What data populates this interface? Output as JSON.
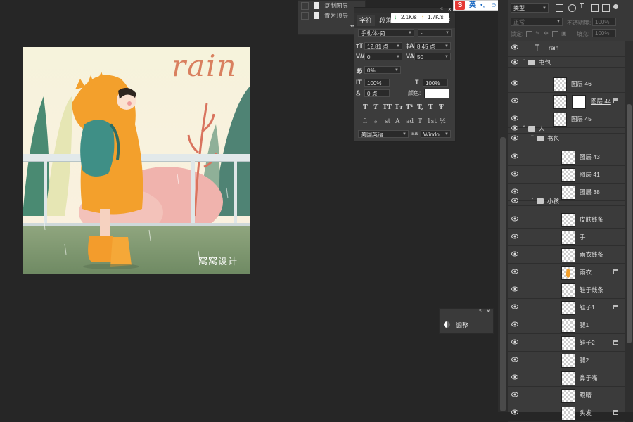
{
  "artwork": {
    "title": "rain",
    "watermark": "窝窝设计"
  },
  "history": {
    "items": [
      {
        "label": "复制图层"
      },
      {
        "label": "置为顶层"
      }
    ]
  },
  "character_panel": {
    "tabs": [
      "字符",
      "段落"
    ],
    "font_family": "手札体-简",
    "font_style": "-",
    "font_size": "12.81 点",
    "leading": "8.45 点",
    "kerning": "0",
    "tracking": "50",
    "tsume": "0%",
    "vertical_scale": "100%",
    "horizontal_scale": "100%",
    "baseline_shift": "0 点",
    "color_label": "颜色:",
    "color_value": "#ffffff",
    "style_buttons": [
      "T",
      "T",
      "TT",
      "Tт",
      "T¹",
      "T,",
      "T",
      "Ŧ"
    ],
    "opentype_buttons": [
      "fi",
      "ℴ",
      "st",
      "A",
      "ad",
      "T",
      "1st",
      "½"
    ],
    "language": "美国英语",
    "aa_label": "aa",
    "antialias": "Windo..."
  },
  "speed": {
    "down": "2.1K/s",
    "up": "1.7K/s"
  },
  "ime": {
    "logo": "S",
    "lang": "英"
  },
  "adjust_panel": {
    "label": "调整"
  },
  "layers_panel": {
    "filter_label": "类型",
    "blend_mode": "正常",
    "opacity_label": "不透明度:",
    "opacity_value": "100%",
    "lock_label": "锁定:",
    "fill_label": "填充:",
    "fill_value": "100%",
    "layers": [
      {
        "name": "rain",
        "type": "text"
      },
      {
        "name": "书包",
        "type": "group"
      },
      {
        "name": "图层 46",
        "type": "layer"
      },
      {
        "name": "图层 44",
        "type": "masked"
      },
      {
        "name": "图层 45",
        "type": "layer"
      },
      {
        "name": "人",
        "type": "group"
      },
      {
        "name": "书包",
        "type": "group"
      },
      {
        "name": "图层 43",
        "type": "layer"
      },
      {
        "name": "图层 41",
        "type": "layer"
      },
      {
        "name": "图层 38",
        "type": "layer"
      },
      {
        "name": "小孩",
        "type": "group"
      },
      {
        "name": "皮肤线条",
        "type": "layer"
      },
      {
        "name": "手",
        "type": "layer"
      },
      {
        "name": "雨衣线条",
        "type": "layer"
      },
      {
        "name": "雨衣",
        "type": "layer"
      },
      {
        "name": "鞋子线条",
        "type": "layer"
      },
      {
        "name": "鞋子1",
        "type": "layer"
      },
      {
        "name": "腿1",
        "type": "layer"
      },
      {
        "name": "鞋子2",
        "type": "layer"
      },
      {
        "name": "腿2",
        "type": "layer"
      },
      {
        "name": "鼻子嘴",
        "type": "layer"
      },
      {
        "name": "眼睛",
        "type": "layer"
      },
      {
        "name": "头发",
        "type": "layer"
      }
    ]
  }
}
